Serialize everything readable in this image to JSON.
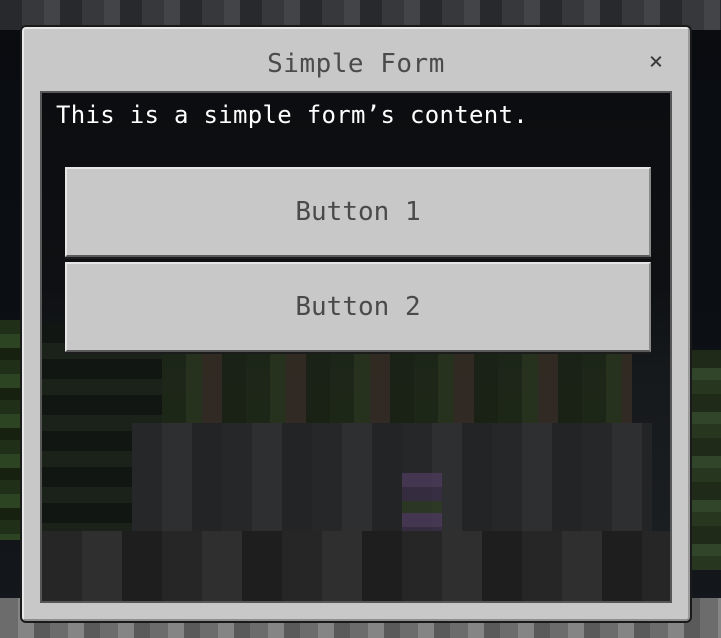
{
  "form": {
    "title": "Simple Form",
    "close_label": "×",
    "content_text": "This is a simple form’s content.",
    "buttons": [
      {
        "label": "Button 1"
      },
      {
        "label": "Button 2"
      }
    ]
  },
  "colors": {
    "panel": "#c8c8c8",
    "title_text": "#4b4b4b",
    "content_text": "#ffffff",
    "button_text": "#4a4a4a"
  },
  "icons": {
    "close": "close-icon"
  }
}
